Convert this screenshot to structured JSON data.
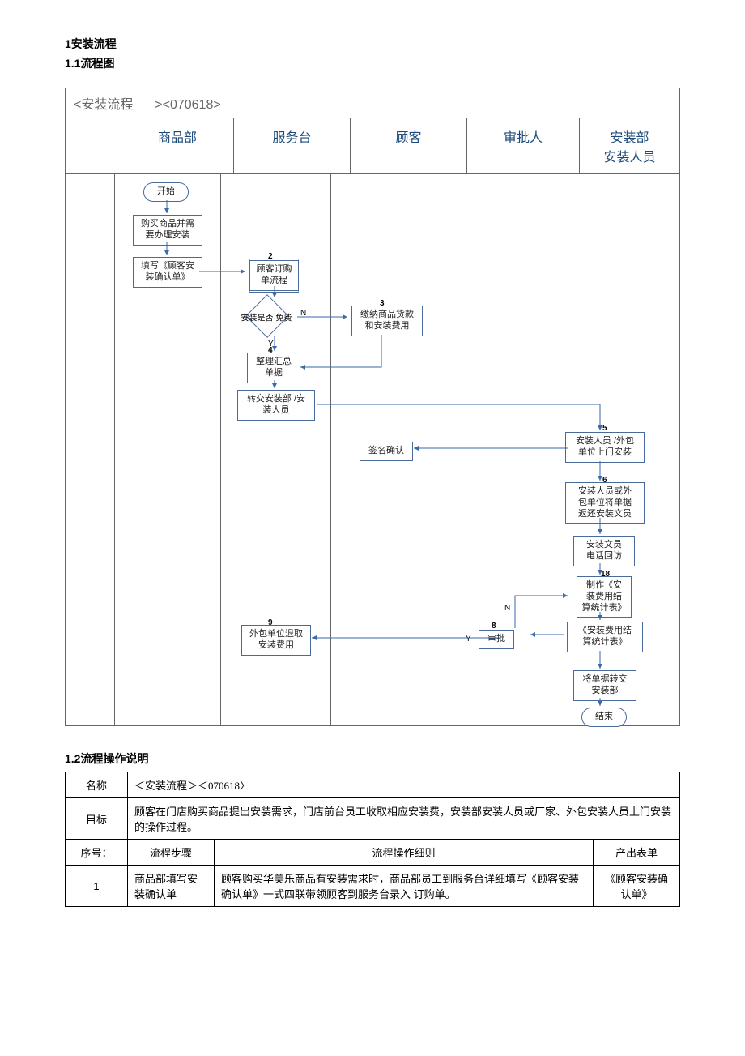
{
  "headings": {
    "h1": "1安装流程",
    "h11": "1.1流程图",
    "h12": "1.2流程操作说明"
  },
  "flow": {
    "title_left": "<安装流程",
    "title_right": "><070618>",
    "lanes": [
      "商品部",
      "服务台",
      "顾客",
      "审批人",
      "安装部\n安装人员"
    ],
    "nodes": {
      "start": "开始",
      "buy": "购买商品并需\n要办理安装",
      "fill": "填写《顾客安\n装确认单》",
      "n2_num": "2",
      "n2": "顾客订购\n单流程",
      "dec": "安装是否\n免费",
      "dec_y": "Y",
      "dec_n": "N",
      "n3_num": "3",
      "n3": "缴纳商品货款\n和安装费用",
      "n4_num": "4",
      "n4": "整理汇总\n单据",
      "trans": "转交安装部  /安\n装人员",
      "sign": "签名确认",
      "n5_num": "5",
      "n5": "安装人员 /外包\n单位上门安装",
      "n6_num": "6",
      "n6": "安装人员或外\n包单位将单据\n返还安装文员",
      "n7": "安装文员\n电话回访",
      "n18_num": "18",
      "make": "制作《安\n装费用结\n算统计表》",
      "n8_num": "8",
      "n8": "审批",
      "n8_y": "Y",
      "n8_n": "N",
      "stat": "《安装费用结\n算统计表》",
      "back": "将单据转交\n安装部",
      "end": "结束",
      "n9_num": "9",
      "n9": "外包单位退取\n安装费用"
    }
  },
  "spec": {
    "name_lbl": "名称",
    "name_val": "＜安装流程＞＜070618〉",
    "goal_lbl": "目标",
    "goal_val": "顾客在门店购买商品提出安装需求，门店前台员工收取相应安装费，安装部安装人员或厂家、外包安装人员上门安装的操作过程。",
    "cols": {
      "num": "序号：",
      "step": "流程步骤",
      "detail": "流程操作细则",
      "out": "产出表单"
    },
    "row1": {
      "num": "1",
      "step": "商品部填写安装确认单",
      "detail": "顾客购买华美乐商品有安装需求时，商品部员工到服务台详细填写《顾客安装确认单》一式四联带领顾客到服务台录入 订购单。",
      "out": "《顾客安装确认单》"
    }
  }
}
